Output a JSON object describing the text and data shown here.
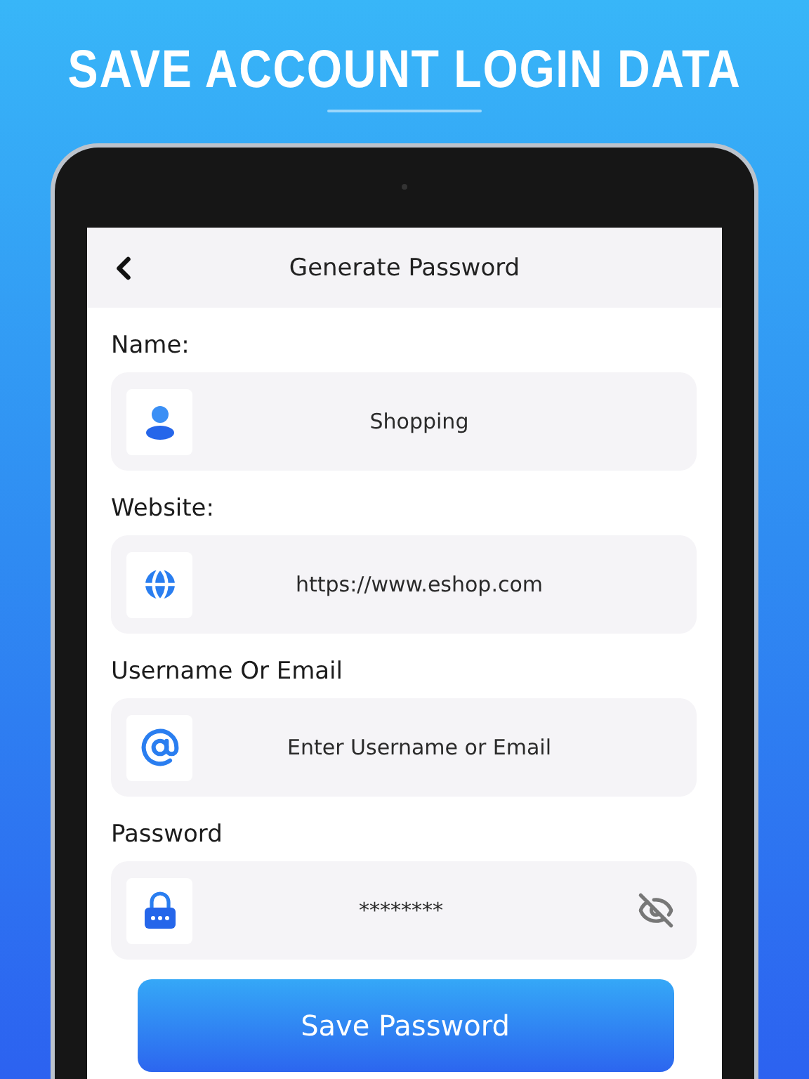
{
  "headline": "SAVE ACCOUNT LOGIN DATA",
  "header": {
    "title": "Generate Password"
  },
  "fields": [
    {
      "label": "Name:",
      "kind": "person",
      "value": "Shopping"
    },
    {
      "label": "Website:",
      "kind": "globe",
      "value": "https://www.eshop.com"
    },
    {
      "label": "Username Or Email",
      "kind": "at",
      "placeholder": "Enter Username or Email"
    },
    {
      "label": "Password",
      "kind": "lock",
      "value": "********",
      "toggle": true
    }
  ],
  "button": "Save Password"
}
